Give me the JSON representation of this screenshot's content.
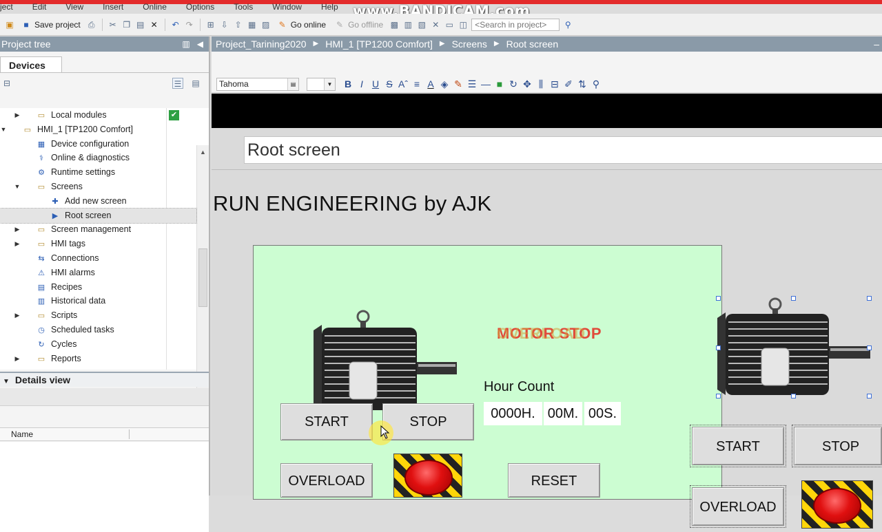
{
  "watermark": "www.BANDICAM.com",
  "menu": [
    "ject",
    "Edit",
    "View",
    "Insert",
    "Online",
    "Options",
    "Tools",
    "Window",
    "Help"
  ],
  "toolbar": {
    "save_label": "Save project",
    "go_online": "Go online",
    "go_offline": "Go offline",
    "search_placeholder": "<Search in project>"
  },
  "project_tree": {
    "title": "Project tree",
    "tab": "Devices",
    "items": [
      {
        "label": "Local modules",
        "arrow": "▶",
        "icon": "folder-icon",
        "checked": true
      },
      {
        "label": "HMI_1 [TP1200 Comfort]",
        "arrow": "▼",
        "icon": "folder-icon"
      },
      {
        "label": "Device configuration",
        "icon": "device-config-icon"
      },
      {
        "label": "Online & diagnostics",
        "icon": "diagnostics-icon"
      },
      {
        "label": "Runtime settings",
        "icon": "runtime-settings-icon"
      },
      {
        "label": "Screens",
        "arrow": "▼",
        "icon": "folder-icon"
      },
      {
        "label": "Add new screen",
        "icon": "add-screen-icon"
      },
      {
        "label": "Root screen",
        "icon": "screen-icon",
        "selected": true
      },
      {
        "label": "Screen management",
        "arrow": "▶",
        "icon": "folder-icon"
      },
      {
        "label": "HMI tags",
        "arrow": "▶",
        "icon": "folder-icon"
      },
      {
        "label": "Connections",
        "icon": "connections-icon"
      },
      {
        "label": "HMI alarms",
        "icon": "alarms-icon"
      },
      {
        "label": "Recipes",
        "icon": "recipes-icon"
      },
      {
        "label": "Historical data",
        "icon": "historical-data-icon"
      },
      {
        "label": "Scripts",
        "arrow": "▶",
        "icon": "folder-icon"
      },
      {
        "label": "Scheduled tasks",
        "icon": "scheduled-tasks-icon"
      },
      {
        "label": "Cycles",
        "icon": "cycles-icon"
      },
      {
        "label": "Reports",
        "arrow": "▶",
        "icon": "folder-icon"
      }
    ]
  },
  "details_view": {
    "title": "Details view",
    "column_name": "Name"
  },
  "breadcrumb": [
    "Project_Tarining2020",
    "HMI_1 [TP1200 Comfort]",
    "Screens",
    "Root screen"
  ],
  "format_toolbar": {
    "font": "Tahoma",
    "size": ""
  },
  "screen": {
    "title": "Root screen",
    "heading": "RUN ENGINEERING by AJK",
    "motor_status": "MOTOR STOP",
    "motor_status_overlay": "OVERLOAD",
    "hour_count_label": "Hour Count",
    "hours": "0000H.",
    "minutes": "00M.",
    "seconds": "00S.",
    "start_label": "START",
    "stop_label": "STOP",
    "overload_label": "OVERLOAD",
    "reset_label": "RESET",
    "right_start_label": "START",
    "right_stop_label": "STOP",
    "right_overload_label": "OVERLOAD"
  },
  "colors": {
    "panel_bg": "#ccfdd2",
    "header_bg": "#8a9aa8",
    "status_text": "#e04a3a",
    "estop_red": "#e01010",
    "estop_stripe": "#ffd60a"
  }
}
